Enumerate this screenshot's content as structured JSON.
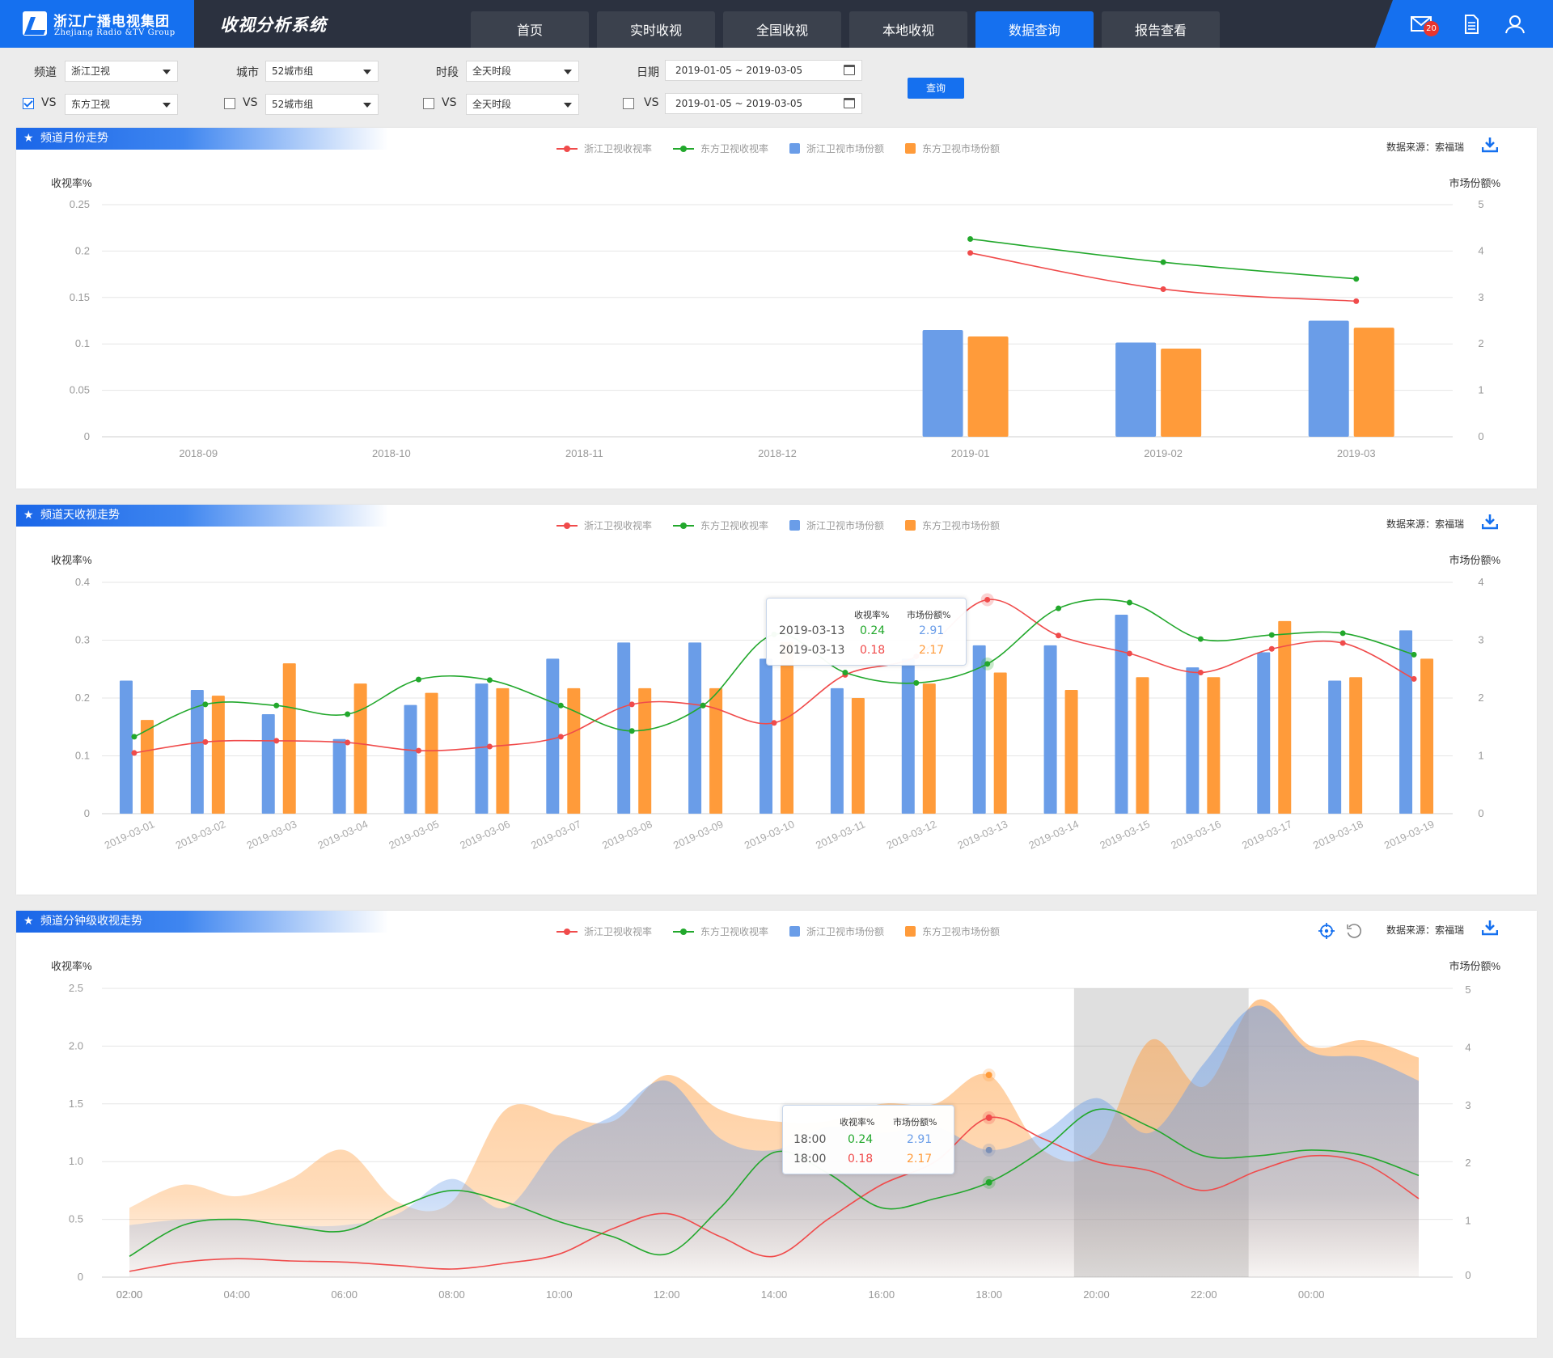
{
  "header": {
    "logo_cn": "浙江广播电视集团",
    "logo_en": "Zhejiang Radio &TV Group",
    "app_title": "收视分析系统",
    "tabs": [
      {
        "label": "首页"
      },
      {
        "label": "实时收视"
      },
      {
        "label": "全国收视"
      },
      {
        "label": "本地收视"
      },
      {
        "label": "数据查询"
      },
      {
        "label": "报告查看"
      }
    ],
    "active_tab": "数据查询",
    "mail_badge": "20",
    "icons": [
      "mail-icon",
      "document-icon",
      "user-icon"
    ]
  },
  "filters": {
    "channel_label": "频道",
    "channel_value": "浙江卫视",
    "vs_label": "VS",
    "vs_channel_value": "东方卫视",
    "vs_channel_checked": true,
    "city_label": "城市",
    "city_value": "52城市组",
    "vs_city_value": "52城市组",
    "vs_city_checked": false,
    "period_label": "时段",
    "period_value": "全天时段",
    "vs_period_value": "全天时段",
    "vs_period_checked": false,
    "date_label": "日期",
    "date_value": "2019-01-05 ~ 2019-03-05",
    "vs_date_value": "2019-01-05 ~ 2019-03-05",
    "vs_date_checked": false,
    "query_button": "查询"
  },
  "common": {
    "legend": [
      {
        "name": "浙江卫视收视率",
        "color": "#f04b4b",
        "kind": "line"
      },
      {
        "name": "东方卫视收视率",
        "color": "#22a82c",
        "kind": "line"
      },
      {
        "name": "浙江卫视市场份额",
        "color": "#6a9de8",
        "kind": "box"
      },
      {
        "name": "东方卫视市场份额",
        "color": "#ff9b3a",
        "kind": "box"
      }
    ],
    "source": "数据来源：索福瑞",
    "left_axis_label": "收视率%",
    "right_axis_label": "市场份额%",
    "colors": {
      "zj_rating": "#f04b4b",
      "df_rating": "#22a82c",
      "zj_share": "#6a9de8",
      "df_share": "#ff9b3a",
      "brand": "#1570ef"
    }
  },
  "monthly": {
    "title": "频道月份走势"
  },
  "daily": {
    "title": "频道天收视走势",
    "tooltip": {
      "head_rating": "收视率%",
      "head_share": "市场份额%",
      "rows": [
        {
          "label": "2019-03-13",
          "rating": "0.24",
          "share": "2.91",
          "rating_color": "#22a82c",
          "share_color": "#6a9de8"
        },
        {
          "label": "2019-03-13",
          "rating": "0.18",
          "share": "2.17",
          "rating_color": "#f04b4b",
          "share_color": "#ff9b3a"
        }
      ]
    }
  },
  "minute": {
    "title": "频道分钟级收视走势",
    "tooltip": {
      "head_rating": "收视率%",
      "head_share": "市场份额%",
      "rows": [
        {
          "label": "18:00",
          "rating": "0.24",
          "share": "2.91",
          "rating_color": "#22a82c",
          "share_color": "#6a9de8"
        },
        {
          "label": "18:00",
          "rating": "0.18",
          "share": "2.17",
          "rating_color": "#f04b4b",
          "share_color": "#ff9b3a"
        }
      ]
    },
    "selected_range": [
      "19:35",
      "22:50"
    ]
  },
  "chart_data": [
    {
      "type": "bar",
      "name": "频道月份走势",
      "categories": [
        "2018-09",
        "2018-10",
        "2018-11",
        "2018-12",
        "2019-01",
        "2019-02",
        "2019-03"
      ],
      "ylabel": "收视率%",
      "y2label": "市场份额%",
      "yticks": [
        "0",
        "0.05",
        "0.1",
        "0.15",
        "0.2",
        "0.25"
      ],
      "y2ticks": [
        "0",
        "1",
        "2",
        "3",
        "4",
        "5"
      ],
      "ylim": [
        0,
        0.25
      ],
      "y2lim": [
        0,
        5
      ],
      "series": [
        {
          "name": "浙江卫视收视率",
          "kind": "line",
          "axis": "left",
          "values": [
            null,
            null,
            null,
            null,
            0.198,
            0.159,
            0.146
          ]
        },
        {
          "name": "东方卫视收视率",
          "kind": "line",
          "axis": "left",
          "values": [
            null,
            null,
            null,
            null,
            0.213,
            0.188,
            0.17
          ]
        },
        {
          "name": "浙江卫视市场份额",
          "kind": "bar",
          "axis": "right",
          "values": [
            null,
            null,
            null,
            null,
            2.3,
            2.03,
            2.5
          ]
        },
        {
          "name": "东方卫视市场份额",
          "kind": "bar",
          "axis": "right",
          "values": [
            null,
            null,
            null,
            null,
            2.16,
            1.9,
            2.35
          ]
        }
      ]
    },
    {
      "type": "bar",
      "name": "频道天收视走势",
      "categories": [
        "2019-03-01",
        "2019-03-02",
        "2019-03-03",
        "2019-03-04",
        "2019-03-05",
        "2019-03-06",
        "2019-03-07",
        "2019-03-08",
        "2019-03-09",
        "2019-03-10",
        "2019-03-11",
        "2019-03-12",
        "2019-03-13",
        "2019-03-14",
        "2019-03-15",
        "2019-03-16",
        "2019-03-17",
        "2019-03-18",
        "2019-03-19"
      ],
      "ylabel": "收视率%",
      "y2label": "市场份额%",
      "yticks": [
        "0",
        "0.1",
        "0.2",
        "0.3",
        "0.4"
      ],
      "y2ticks": [
        "0",
        "1",
        "2",
        "3",
        "4"
      ],
      "ylim": [
        0,
        0.4
      ],
      "y2lim": [
        0,
        4
      ],
      "series": [
        {
          "name": "浙江卫视收视率",
          "kind": "line",
          "axis": "left",
          "values": [
            0.105,
            0.124,
            0.126,
            0.123,
            0.109,
            0.116,
            0.133,
            0.189,
            0.187,
            0.157,
            0.24,
            0.272,
            0.37,
            0.308,
            0.277,
            0.244,
            0.285,
            0.295,
            0.233
          ]
        },
        {
          "name": "东方卫视收视率",
          "kind": "line",
          "axis": "left",
          "values": [
            0.133,
            0.189,
            0.187,
            0.172,
            0.232,
            0.231,
            0.187,
            0.143,
            0.187,
            0.31,
            0.244,
            0.226,
            0.259,
            0.355,
            0.365,
            0.302,
            0.309,
            0.312,
            0.275
          ]
        },
        {
          "name": "浙江卫视市场份额",
          "kind": "bar",
          "axis": "right",
          "values": [
            2.3,
            2.14,
            1.72,
            1.29,
            1.88,
            2.25,
            2.68,
            2.96,
            2.96,
            2.68,
            2.17,
            2.68,
            2.91,
            2.91,
            3.44,
            2.53,
            2.79,
            2.3,
            3.17
          ]
        },
        {
          "name": "东方卫视市场份额",
          "kind": "bar",
          "axis": "right",
          "values": [
            1.62,
            2.04,
            2.6,
            2.25,
            2.09,
            2.17,
            2.17,
            2.17,
            2.17,
            2.97,
            2.0,
            2.25,
            2.44,
            2.14,
            2.36,
            2.36,
            3.33,
            2.36,
            2.68
          ]
        }
      ]
    },
    {
      "type": "area",
      "name": "频道分钟级收视走势",
      "x": [
        "02:00",
        "03:00",
        "04:00",
        "05:00",
        "06:00",
        "07:00",
        "08:00",
        "09:00",
        "10:00",
        "11:00",
        "12:00",
        "13:00",
        "14:00",
        "15:00",
        "16:00",
        "17:00",
        "18:00",
        "19:00",
        "20:00",
        "21:00",
        "22:00",
        "23:00",
        "00:00",
        "01:00",
        "02:00"
      ],
      "xticks": [
        "02:00",
        "04:00",
        "06:00",
        "08:00",
        "10:00",
        "12:00",
        "14:00",
        "16:00",
        "18:00",
        "20:00",
        "22:00",
        "00:00",
        "02:00"
      ],
      "ylabel": "收视率%",
      "y2label": "市场份额%",
      "yticks": [
        "0",
        "0.5",
        "1.0",
        "1.5",
        "2.0",
        "2.5"
      ],
      "y2ticks": [
        "0",
        "1",
        "2",
        "3",
        "4",
        "5"
      ],
      "ylim": [
        0,
        2.5
      ],
      "y2lim": [
        0,
        5
      ],
      "series": [
        {
          "name": "浙江卫视收视率",
          "kind": "line",
          "axis": "left",
          "values": [
            0.05,
            0.13,
            0.16,
            0.14,
            0.13,
            0.1,
            0.07,
            0.12,
            0.2,
            0.42,
            0.55,
            0.35,
            0.18,
            0.5,
            0.8,
            1.0,
            1.38,
            1.2,
            1.0,
            0.92,
            0.75,
            0.92,
            1.05,
            0.98,
            0.68
          ]
        },
        {
          "name": "东方卫视收视率",
          "kind": "line",
          "axis": "left",
          "values": [
            0.18,
            0.45,
            0.5,
            0.44,
            0.4,
            0.6,
            0.75,
            0.65,
            0.48,
            0.35,
            0.2,
            0.6,
            1.08,
            0.9,
            0.6,
            0.68,
            0.82,
            1.1,
            1.45,
            1.3,
            1.05,
            1.05,
            1.1,
            1.05,
            0.88
          ]
        },
        {
          "name": "浙江卫视市场份额",
          "kind": "area",
          "axis": "right",
          "values": [
            0.9,
            1.0,
            1.0,
            0.9,
            0.9,
            1.1,
            1.7,
            1.2,
            2.3,
            2.8,
            3.4,
            2.4,
            2.2,
            2.6,
            2.5,
            2.6,
            2.2,
            2.5,
            3.1,
            2.5,
            3.7,
            4.7,
            3.9,
            3.8,
            3.4
          ]
        },
        {
          "name": "东方卫视市场份额",
          "kind": "area",
          "axis": "right",
          "values": [
            1.2,
            1.6,
            1.4,
            1.7,
            2.2,
            1.3,
            1.3,
            2.9,
            2.8,
            2.7,
            3.5,
            2.9,
            2.7,
            2.7,
            3.0,
            3.0,
            3.5,
            2.2,
            2.2,
            4.1,
            3.3,
            4.8,
            4.0,
            4.1,
            3.8
          ]
        }
      ]
    }
  ]
}
